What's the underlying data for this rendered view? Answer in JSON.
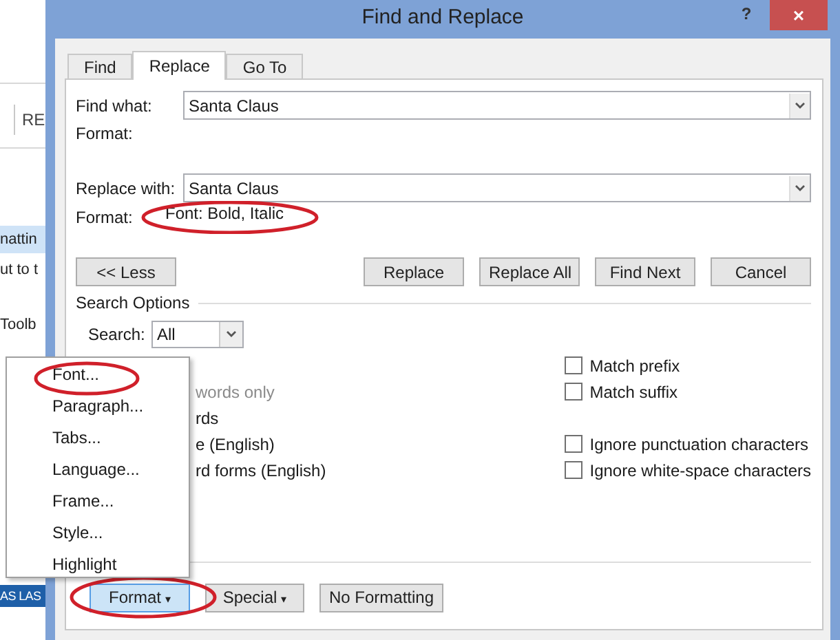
{
  "background_app": {
    "ribbon_fragment": "RE",
    "items": [
      {
        "text": "nattin",
        "selected": true
      },
      {
        "text": "ut to t",
        "selected": false
      },
      {
        "text": "Toolb",
        "selected": false
      }
    ],
    "bar_text": "AS LAS"
  },
  "window": {
    "title": "Find and Replace",
    "help": "?",
    "close": "×"
  },
  "tabs": [
    {
      "label": "Find",
      "selected": false
    },
    {
      "label": "Replace",
      "selected": true
    },
    {
      "label": "Go To",
      "selected": false
    }
  ],
  "find": {
    "label": "Find what:",
    "value": "Santa Claus",
    "format_label": "Format:"
  },
  "replace": {
    "label": "Replace with:",
    "value": "Santa Claus",
    "format_label": "Format:",
    "format_value": "Font: Bold, Italic"
  },
  "buttons": [
    "<< Less",
    "Replace",
    "Replace All",
    "Find Next",
    "Cancel"
  ],
  "search_options": {
    "title": "Search Options",
    "search_label": "Search:",
    "search_value": "All"
  },
  "left_options": [
    {
      "text": "words only",
      "disabled": true
    },
    {
      "text": "rds",
      "disabled": false
    },
    {
      "text": "e (English)",
      "disabled": false
    },
    {
      "text": "rd forms (English)",
      "disabled": false
    }
  ],
  "right_option_groups": [
    [
      {
        "label": "Match prefix",
        "checked": false
      },
      {
        "label": "Match suffix",
        "checked": false
      }
    ],
    [
      {
        "label": "Ignore punctuation characters",
        "checked": false
      },
      {
        "label": "Ignore white-space characters",
        "checked": false
      }
    ]
  ],
  "bottom_buttons": [
    {
      "label": "Format",
      "caret": "▾",
      "pressed": true
    },
    {
      "label": "Special",
      "caret": "▾",
      "pressed": false
    },
    {
      "label": "No Formatting",
      "pressed": false
    }
  ],
  "format_menu": [
    "Font...",
    "Paragraph...",
    "Tabs...",
    "Language...",
    "Frame...",
    "Style...",
    "Highlight"
  ]
}
